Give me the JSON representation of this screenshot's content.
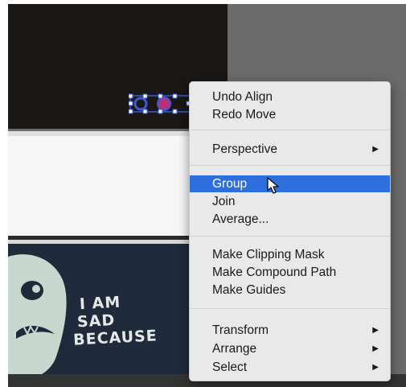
{
  "context_menu": {
    "items": [
      {
        "label": "Undo Align"
      },
      {
        "label": "Redo Move"
      },
      {
        "label": "Perspective",
        "submenu_icon": "chevron-right-icon"
      },
      {
        "label": "Group",
        "highlighted": true
      },
      {
        "label": "Join"
      },
      {
        "label": "Average..."
      },
      {
        "label": "Make Clipping Mask"
      },
      {
        "label": "Make Compound Path"
      },
      {
        "label": "Make Guides"
      },
      {
        "label": "Transform",
        "submenu_icon": "chevron-right-icon"
      },
      {
        "label": "Arrange",
        "submenu_icon": "chevron-right-icon"
      },
      {
        "label": "Select",
        "submenu_icon": "chevron-right-icon"
      }
    ],
    "highlight_color": "#2c6fdd"
  },
  "artwork": {
    "poster_text": [
      "I AM",
      "SAD",
      "BECAUSE"
    ]
  }
}
